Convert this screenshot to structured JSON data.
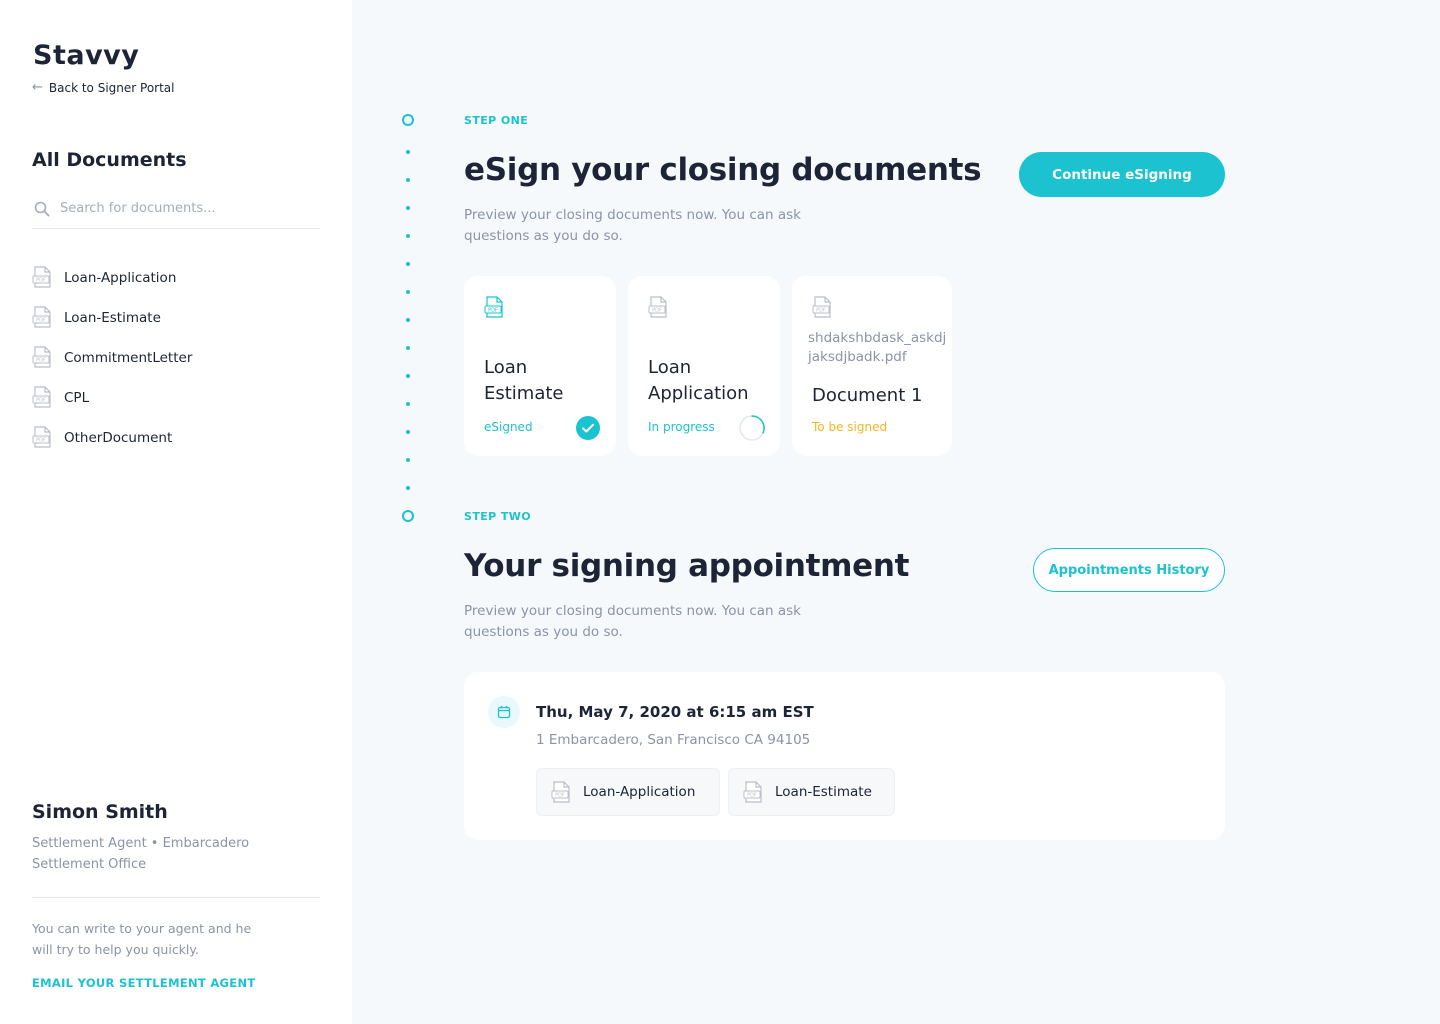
{
  "sidebar": {
    "logo": "Stavvy",
    "back_label": "Back to Signer Portal",
    "all_docs_title": "All Documents",
    "search_placeholder": "Search for documents...",
    "documents": [
      "Loan-Application",
      "Loan-Estimate",
      "CommitmentLetter",
      "CPL",
      "OtherDocument"
    ],
    "agent": {
      "name": "Simon Smith",
      "role": "Settlement Agent • Embarcadero Settlement Office",
      "help_text": "You can write to your agent and he will try to help you quickly.",
      "email_link": "EMAIL YOUR SETTLEMENT AGENT"
    }
  },
  "step_one": {
    "label": "STEP ONE",
    "title": "eSign your closing documents",
    "description": "Preview your closing documents now. You can ask questions as you do so.",
    "button": "Continue eSigning",
    "cards": [
      {
        "title": "Loan Estimate",
        "status": "eSigned",
        "status_color": "#1cc2d0",
        "icon": "pdf-icon-active"
      },
      {
        "title": "Loan Application",
        "status": "In progress",
        "status_color": "#1cc2d0",
        "icon": "pdf-icon"
      },
      {
        "filename": "shdakshbdask_askdjjaksdjbadk.pdf",
        "title": "Document 1",
        "status": "To be signed",
        "status_color": "#f5b51e",
        "icon": "pdf-icon"
      }
    ]
  },
  "step_two": {
    "label": "STEP TWO",
    "title": "Your signing appointment",
    "description": "Preview your closing documents now. You can ask questions as you do so.",
    "button": "Appointments History",
    "appointment": {
      "date": "Thu, May 7, 2020 at 6:15 am EST",
      "address": "1 Embarcadero, San Francisco CA 94105",
      "documents": [
        "Loan-Application",
        "Loan-Estimate"
      ]
    }
  },
  "colors": {
    "accent": "#1cc2d0",
    "warning": "#f5b51e",
    "text": "#1c2435",
    "muted": "#8a94a6"
  }
}
